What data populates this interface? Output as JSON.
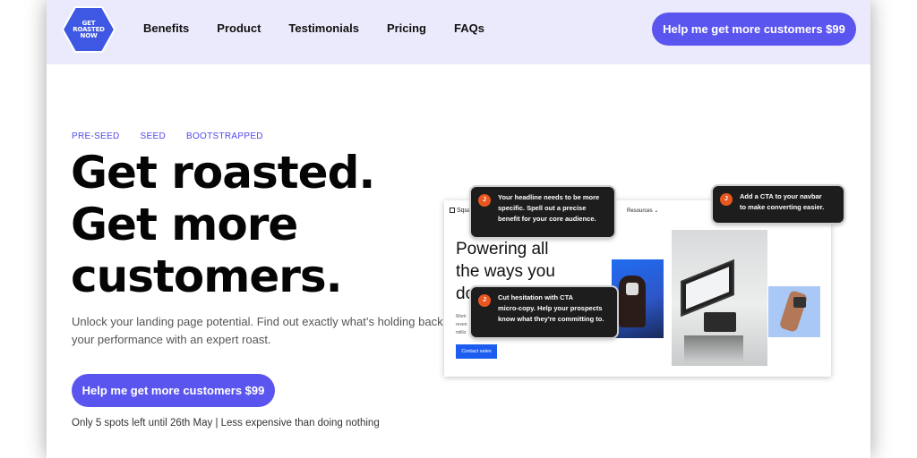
{
  "brand": {
    "logo_text": [
      "GET",
      "ROASTED",
      "NOW"
    ],
    "colors": {
      "accent": "#5b55ef",
      "navbar_bg": "#ebeafc",
      "tag_color": "#5249e8",
      "logo_bg": "#3f58e3"
    }
  },
  "nav": {
    "links": [
      "Benefits",
      "Product",
      "Testimonials",
      "Pricing",
      "FAQs"
    ],
    "cta_label": "Help me get more customers $99"
  },
  "hero": {
    "tags": [
      "PRE-SEED",
      "SEED",
      "BOOTSTRAPPED"
    ],
    "headline_lines": [
      "Get roasted.",
      "Get more",
      "customers."
    ],
    "subtext": "Unlock your landing page potential. Find out exactly what’s holding back your performance with an expert roast.",
    "cta_label": "Help me get more customers $99",
    "scarcity": "Only 5 spots left until 26th  May | Less expensive than doing nothing"
  },
  "mockup": {
    "logo_text": "Squa",
    "nav_items": [
      "ing",
      "Resources ⌄"
    ],
    "headline_lines": [
      "Powering all",
      "the ways you",
      "do"
    ],
    "body_lines": [
      "Work",
      "reven",
      "millio"
    ],
    "button_label": "Contact sales"
  },
  "comments": [
    {
      "avatar": "J",
      "lines": [
        "Your headline needs to be more",
        "specific. Spell out a precise",
        "benefit for your core audience."
      ]
    },
    {
      "avatar": "J",
      "lines": [
        "Add a CTA to your navbar",
        "to make converting easier."
      ]
    },
    {
      "avatar": "J",
      "lines": [
        "Cut hesitation with CTA",
        "micro-copy. Help your prospects",
        "know what they're committing to."
      ]
    }
  ]
}
